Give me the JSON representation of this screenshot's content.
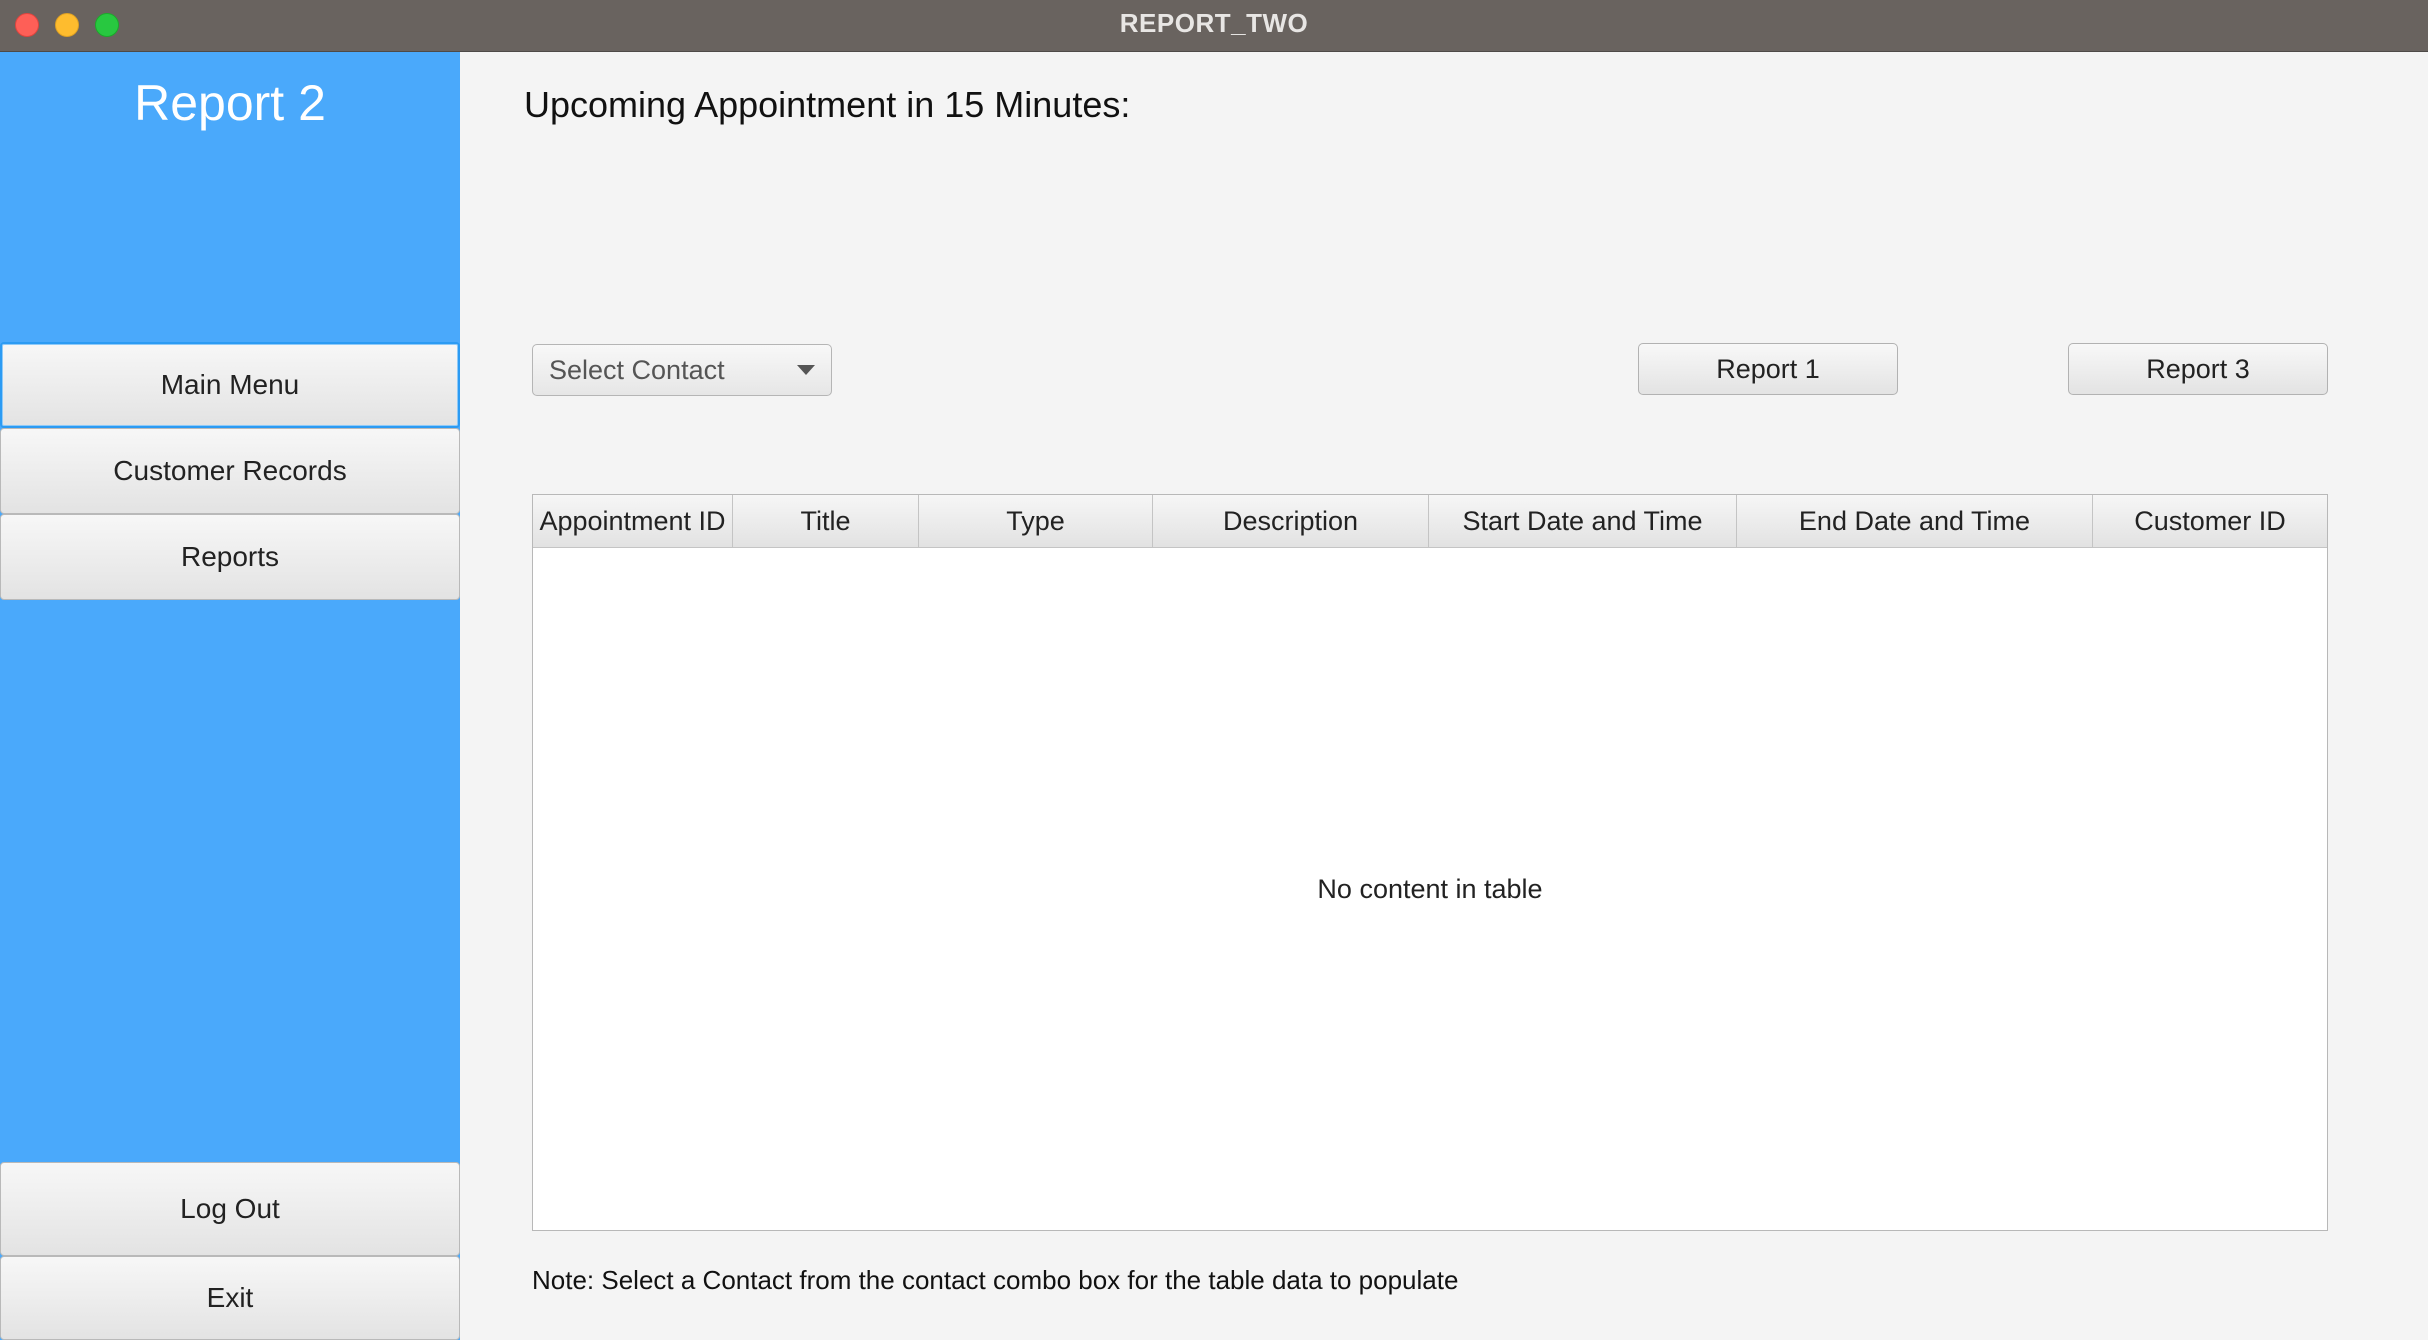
{
  "window": {
    "title": "REPORT_TWO"
  },
  "sidebar": {
    "title": "Report 2",
    "nav": [
      "Main Menu",
      "Customer Records",
      "Reports"
    ],
    "bottom": [
      "Log Out",
      "Exit"
    ]
  },
  "main": {
    "heading": "Upcoming Appointment in 15 Minutes:",
    "contact_select": {
      "placeholder": "Select Contact"
    },
    "report1_label": "Report 1",
    "report3_label": "Report 3",
    "table": {
      "columns": [
        "Appointment ID",
        "Title",
        "Type",
        "Description",
        "Start Date and Time",
        "End Date and Time",
        "Customer ID"
      ],
      "empty_message": "No content in table"
    },
    "note": "Note: Select a Contact from the contact combo box for the table data to populate"
  },
  "colors": {
    "sidebar": "#4aa9fb",
    "titlebar": "#69635f",
    "focus": "#2c9bf3"
  }
}
